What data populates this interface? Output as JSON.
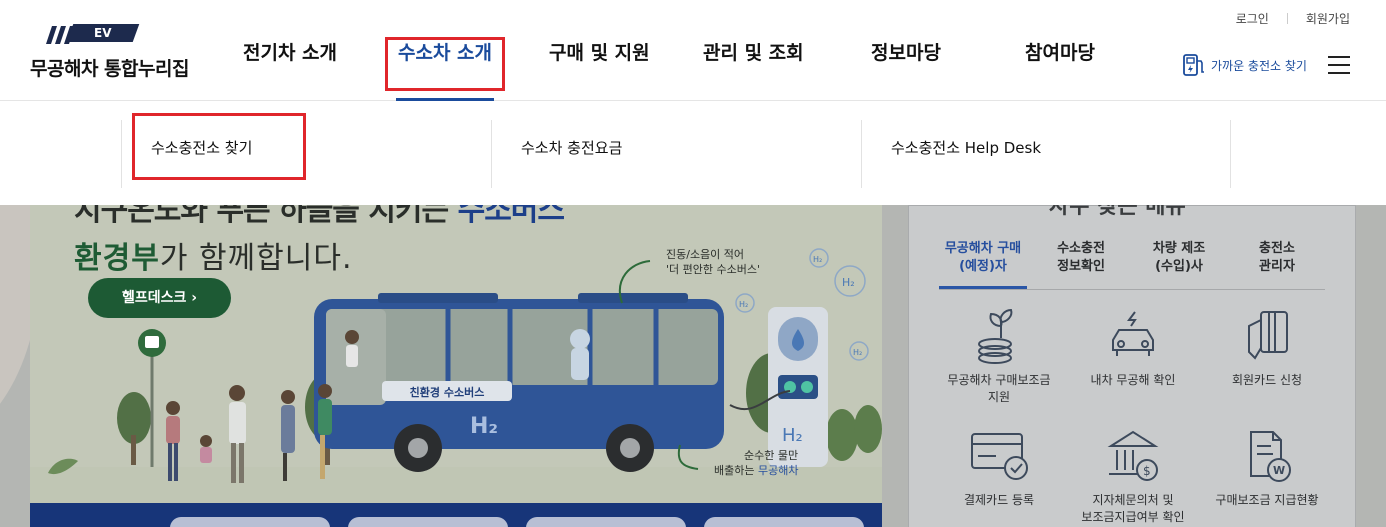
{
  "header": {
    "util_links": [
      "로그인",
      "회원가입"
    ],
    "logo_badge": "EV",
    "logo_text": "무공해차 통합누리집",
    "nav": [
      {
        "label": "전기차 소개",
        "active": false
      },
      {
        "label": "수소차 소개",
        "active": true
      },
      {
        "label": "구매 및 지원",
        "active": false
      },
      {
        "label": "관리 및 조회",
        "active": false
      },
      {
        "label": "정보마당",
        "active": false
      },
      {
        "label": "참여마당",
        "active": false
      }
    ],
    "charger_link": "가까운 충전소 찾기",
    "menu_icon": "hamburger-menu-icon"
  },
  "dropdown": {
    "items": [
      "수소충전소 찾기",
      "수소차 충전요금",
      "수소충전소 Help Desk"
    ]
  },
  "banner": {
    "headline_prefix": "지구온도와 푸른 하늘을 지키는",
    "headline_highlight": "수소버스",
    "sub_highlight": "환경부",
    "sub_rest": "가 함께합니다.",
    "help_button": "헬프데스크",
    "bus_sign": "친환경 수소버스",
    "bus_h2": "H₂",
    "note_quiet_line1": "진동/소음이 적어",
    "note_quiet_line2": "'더 편안한 수소버스'",
    "note_water_line1": "순수한 물만",
    "note_water_line2_a": "배출하는",
    "note_water_line2_b": "무공해차",
    "station_h2": "H₂",
    "h2_bubbles": [
      "H₂",
      "H₂",
      "H₂",
      "H₂"
    ]
  },
  "panel": {
    "title": "자주 찾는 메뉴",
    "tabs": [
      {
        "line1": "무공해차 구매",
        "line2": "(예정)자",
        "active": true
      },
      {
        "line1": "수소충전",
        "line2": "정보확인",
        "active": false
      },
      {
        "line1": "차량 제조",
        "line2": "(수입)사",
        "active": false
      },
      {
        "line1": "충전소",
        "line2": "관리자",
        "active": false
      }
    ],
    "services": [
      {
        "line1": "무공해차 구매보조금",
        "line2": "지원",
        "icon": "coin-plant-icon"
      },
      {
        "line1": "내차 무공해 확인",
        "line2": "",
        "icon": "car-check-icon"
      },
      {
        "line1": "회원카드 신청",
        "line2": "",
        "icon": "member-card-icon"
      },
      {
        "line1": "결제카드 등록",
        "line2": "",
        "icon": "payment-card-icon"
      },
      {
        "line1": "지자체문의처 및",
        "line2": "보조금지급여부 확인",
        "icon": "government-building-icon"
      },
      {
        "line1": "구매보조금 지급현황",
        "line2": "",
        "icon": "subsidy-document-icon"
      }
    ]
  },
  "colors": {
    "primary": "#1a4b9c",
    "highlight_box": "#e0262b",
    "help_button": "#1d5a34",
    "dim_overlay": "#b4b6b3"
  }
}
